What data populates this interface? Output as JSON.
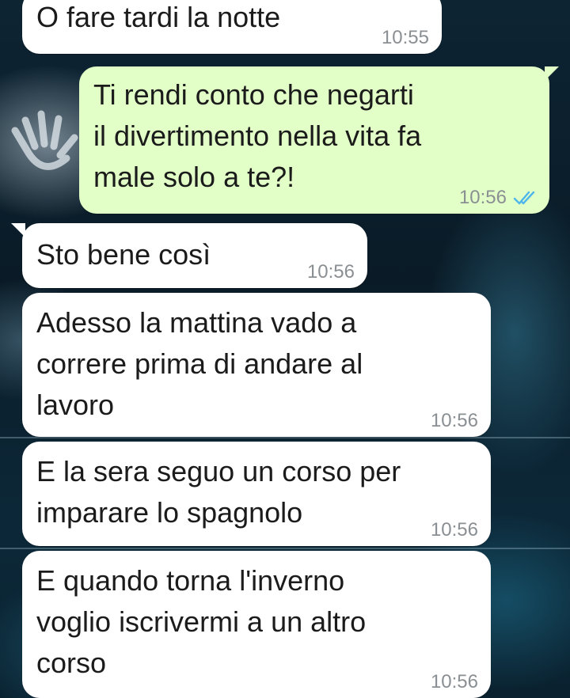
{
  "messages": [
    {
      "direction": "incoming",
      "text": "O fare tardi la notte",
      "time": "10:55"
    },
    {
      "direction": "outgoing",
      "text": "Ti rendi conto che negarti\nil divertimento nella vita fa\nmale solo a te?!",
      "time": "10:56",
      "status": "read"
    },
    {
      "direction": "incoming",
      "text": "Sto bene così",
      "time": "10:56"
    },
    {
      "direction": "incoming",
      "text": "Adesso la mattina vado a\ncorrere prima di andare al\nlavoro",
      "time": "10:56"
    },
    {
      "direction": "incoming",
      "text": "E la sera seguo un corso per\nimparare lo spagnolo",
      "time": "10:56"
    },
    {
      "direction": "incoming",
      "text": "E quando torna l'inverno\nvoglio iscrivermi a un altro\ncorso",
      "time": "10:56"
    }
  ],
  "colors": {
    "incoming_bubble": "#ffffff",
    "outgoing_bubble": "#e2ffc7",
    "timestamp": "#8a8f93",
    "read_ticks": "#4fb6ec"
  },
  "icons": {
    "read_receipt": "double-check-icon"
  }
}
